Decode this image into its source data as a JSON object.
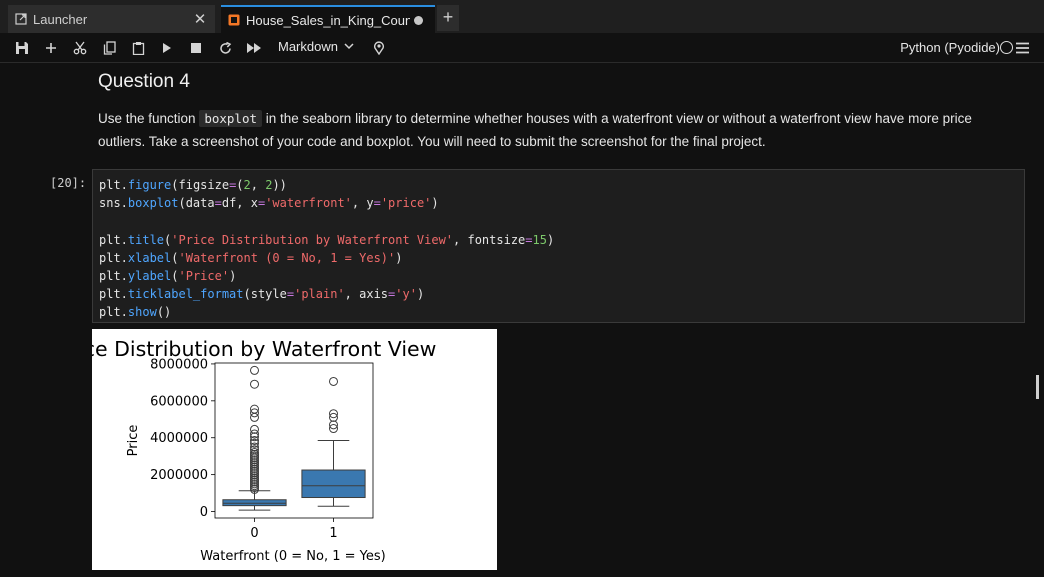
{
  "tabs": [
    {
      "label": "Launcher"
    },
    {
      "label": "House_Sales_in_King_Count_"
    }
  ],
  "toolbar": {
    "cell_type": "Markdown",
    "kernel": "Python (Pyodide)"
  },
  "notebook": {
    "heading": "Question 4",
    "para_before": "Use the function ",
    "para_code": "boxplot",
    "para_after": " in the seaborn library to determine whether houses with a waterfront view or without a waterfront view have more price outliers. Take a screenshot of your code and boxplot. You will need to submit the screenshot for the final project.",
    "prompt": "[20]:",
    "code": {
      "l1a": "plt.",
      "l1b": "figure",
      "l1c": "(figsize",
      "l1d": "=",
      "l1e": "(",
      "l1f": "2",
      "l1g": ", ",
      "l1h": "2",
      "l1i": "))",
      "l2a": "sns.",
      "l2b": "boxplot",
      "l2c": "(data",
      "l2d": "=",
      "l2e": "df, x",
      "l2f": "=",
      "l2g": "'waterfront'",
      "l2h": ", y",
      "l2i": "=",
      "l2j": "'price'",
      "l2k": ")",
      "l4a": "plt.",
      "l4b": "title",
      "l4c": "(",
      "l4d": "'Price Distribution by Waterfront View'",
      "l4e": ", fontsize",
      "l4f": "=",
      "l4g": "15",
      "l4h": ")",
      "l5a": "plt.",
      "l5b": "xlabel",
      "l5c": "(",
      "l5d": "'Waterfront (0 = No, 1 = Yes)'",
      "l5e": ")",
      "l6a": "plt.",
      "l6b": "ylabel",
      "l6c": "(",
      "l6d": "'Price'",
      "l6e": ")",
      "l7a": "plt.",
      "l7b": "ticklabel_format",
      "l7c": "(style",
      "l7d": "=",
      "l7e": "'plain'",
      "l7f": ", axis",
      "l7g": "=",
      "l7h": "'y'",
      "l7i": ")",
      "l8a": "plt.",
      "l8b": "show",
      "l8c": "()"
    }
  },
  "chart_data": {
    "type": "box",
    "title": "Price Distribution by Waterfront View",
    "xlabel": "Waterfront (0 = No, 1 = Yes)",
    "ylabel": "Price",
    "categories": [
      "0",
      "1"
    ],
    "ylim": [
      -350000,
      8050000
    ],
    "yticks": [
      0,
      2000000,
      4000000,
      6000000,
      8000000
    ],
    "ytick_labels": [
      "0",
      "2000000",
      "4000000",
      "6000000",
      "8000000"
    ],
    "box_color": "#3a78b0",
    "boxes": [
      {
        "category": "0",
        "whisker_low": 78000,
        "q1": 320000,
        "median": 450000,
        "q3": 640000,
        "whisker_high": 1130000,
        "outliers": [
          1200000,
          1300000,
          1400000,
          1500000,
          1600000,
          1700000,
          1800000,
          1900000,
          2000000,
          2100000,
          2200000,
          2300000,
          2400000,
          2500000,
          2600000,
          2700000,
          2800000,
          2900000,
          3000000,
          3100000,
          3200000,
          3350000,
          3500000,
          3700000,
          3850000,
          4050000,
          4200000,
          4450000,
          5100000,
          5350000,
          5550000,
          6900000,
          7650000
        ]
      },
      {
        "category": "1",
        "whisker_low": 285000,
        "q1": 760000,
        "median": 1400000,
        "q3": 2250000,
        "whisker_high": 3850000,
        "outliers": [
          4500000,
          4700000,
          5100000,
          5300000,
          7050000
        ]
      }
    ]
  }
}
